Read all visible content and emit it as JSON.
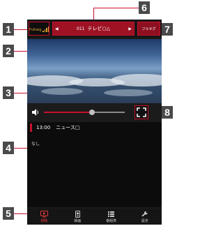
{
  "callouts": [
    "1",
    "2",
    "3",
    "4",
    "5",
    "6",
    "7",
    "8"
  ],
  "header": {
    "signal_label": "Fullseg",
    "channel_number": "011",
    "channel_name": "テレビ○△",
    "fullseg_button": "フルセグ"
  },
  "program": {
    "time": "13:00",
    "title": "ニュース□",
    "detail": "なし"
  },
  "nav": [
    {
      "label": "視聴",
      "icon": "tv-icon"
    },
    {
      "label": "録画",
      "icon": "record-icon"
    },
    {
      "label": "番組表",
      "icon": "list-icon"
    },
    {
      "label": "設定",
      "icon": "wrench-icon"
    }
  ],
  "colors": {
    "accent": "#c8102e",
    "active_nav": "#e53a3a"
  }
}
